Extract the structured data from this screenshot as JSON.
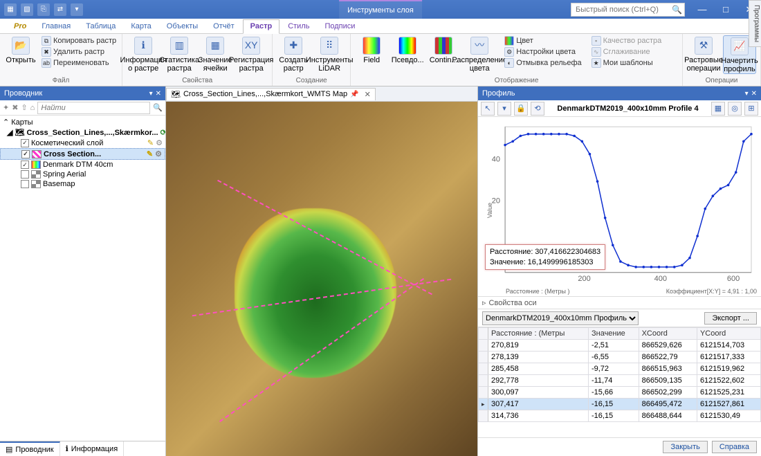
{
  "titlebar": {
    "context_title": "Инструменты слоя",
    "search_placeholder": "Быстрый поиск (Ctrl+Q)"
  },
  "tabs": {
    "pro": "Pro",
    "home": "Главная",
    "table": "Таблица",
    "map": "Карта",
    "objects": "Объекты",
    "report": "Отчёт",
    "raster": "Растр",
    "style": "Стиль",
    "labels": "Подписи"
  },
  "ribbon": {
    "file": {
      "open": "Открыть",
      "copy": "Копировать растр",
      "delete": "Удалить растр",
      "rename": "Переименовать",
      "label": "Файл"
    },
    "props": {
      "info": "Информация о растре",
      "stats": "Статистика растра",
      "cell": "Значение ячейки",
      "reg": "Регистрация растра",
      "label": "Свойства"
    },
    "create": {
      "create": "Создать растр",
      "lidar": "Инструменты LiDAR",
      "label": "Создание"
    },
    "display": {
      "field": "Field",
      "pseudo": "Псевдо...",
      "contin": "Contin...",
      "dist": "Распределение цвета",
      "color": "Цвет",
      "color_settings": "Настройки цвета",
      "hillshade": "Отмывка рельефа",
      "quality": "Качество растра",
      "smoothing": "Сглаживание",
      "templates": "Мои шаблоны",
      "label": "Отображение"
    },
    "ops": {
      "raster_ops": "Растровые операции",
      "profile": "Начертить профиль",
      "label": "Операции"
    }
  },
  "explorer": {
    "title": "Проводник",
    "find_placeholder": "Найти",
    "group_maps": "Карты",
    "root": "Cross_Section_Lines,...,Skærmkor...",
    "cosmetic": "Косметический слой",
    "sel": "Cross Section...",
    "dtm": "Denmark DTM 40cm",
    "spring": "Spring Aerial",
    "basemap": "Basemap",
    "tab_explorer": "Проводник",
    "tab_info": "Информация"
  },
  "doc": {
    "tab_title": "Cross_Section_Lines,...,Skærmkort_WMTS Map"
  },
  "side_tab": "Программы",
  "profile": {
    "title": "Профиль",
    "axis_props": "Свойства оси",
    "select_value": "DenmarkDTM2019_400x10mm Профиль",
    "export": "Экспорт ...",
    "close": "Закрыть",
    "help": "Справка",
    "x_label": "Расстояние : (Метры )",
    "y_label": "Value",
    "ratio": "Коэффициент[X:Y] = 4,91 : 1,00",
    "tooltip_dist_label": "Расстояние:",
    "tooltip_dist_val": "307,416622304683",
    "tooltip_val_label": "Значение:",
    "tooltip_val_val": "16,1499996185303"
  },
  "chart_data": {
    "type": "line",
    "title": "DenmarkDTM2019_400x10mm Profile 4",
    "xlabel": "Расстояние : (Метры )",
    "ylabel": "Value",
    "xlim": [
      0,
      640
    ],
    "ylim": [
      -20,
      60
    ],
    "x_ticks": [
      200,
      400,
      600
    ],
    "y_ticks": [
      20,
      40
    ],
    "series": [
      {
        "name": "Profile 4",
        "x": [
          0,
          20,
          40,
          60,
          80,
          100,
          120,
          140,
          160,
          180,
          200,
          220,
          240,
          260,
          280,
          300,
          320,
          340,
          360,
          380,
          400,
          420,
          440,
          460,
          480,
          500,
          520,
          540,
          560,
          580,
          600,
          620,
          640
        ],
        "y": [
          50,
          52,
          55,
          56,
          56,
          56,
          56,
          56,
          56,
          55,
          52,
          45,
          30,
          10,
          -5,
          -14,
          -16,
          -17,
          -17,
          -17,
          -17,
          -17,
          -17,
          -16,
          -12,
          0,
          15,
          22,
          26,
          28,
          35,
          52,
          56
        ]
      }
    ]
  },
  "grid": {
    "cols": [
      "Расстояние : (Метры",
      "Значение",
      "XCoord",
      "YCoord"
    ],
    "rows": [
      [
        "270,819",
        "-2,51",
        "866529,626",
        "6121514,703"
      ],
      [
        "278,139",
        "-6,55",
        "866522,79",
        "6121517,333"
      ],
      [
        "285,458",
        "-9,72",
        "866515,963",
        "6121519,962"
      ],
      [
        "292,778",
        "-11,74",
        "866509,135",
        "6121522,602"
      ],
      [
        "300,097",
        "-15,66",
        "866502,299",
        "6121525,231"
      ],
      [
        "307,417",
        "-16,15",
        "866495,472",
        "6121527,861"
      ],
      [
        "314,736",
        "-16,15",
        "866488,644",
        "6121530,49"
      ]
    ],
    "selected_index": 5
  }
}
